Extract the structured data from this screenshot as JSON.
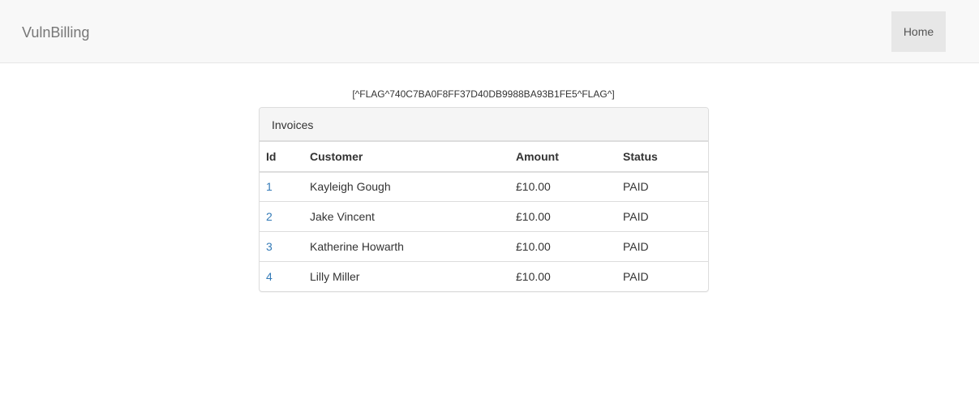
{
  "navbar": {
    "brand": "VulnBilling",
    "home_label": "Home"
  },
  "flag_text": "[^FLAG^740C7BA0F8FF37D40DB9988BA93B1FE5^FLAG^]",
  "panel": {
    "title": "Invoices",
    "columns": [
      "Id",
      "Customer",
      "Amount",
      "Status"
    ],
    "rows": [
      {
        "id": "1",
        "customer": "Kayleigh Gough",
        "amount": "£10.00",
        "status": "PAID"
      },
      {
        "id": "2",
        "customer": "Jake Vincent",
        "amount": "£10.00",
        "status": "PAID"
      },
      {
        "id": "3",
        "customer": "Katherine Howarth",
        "amount": "£10.00",
        "status": "PAID"
      },
      {
        "id": "4",
        "customer": "Lilly Miller",
        "amount": "£10.00",
        "status": "PAID"
      }
    ]
  },
  "colors": {
    "link": "#337ab7",
    "navbar_bg": "#f8f8f8",
    "active_nav_bg": "#e7e7e7"
  }
}
